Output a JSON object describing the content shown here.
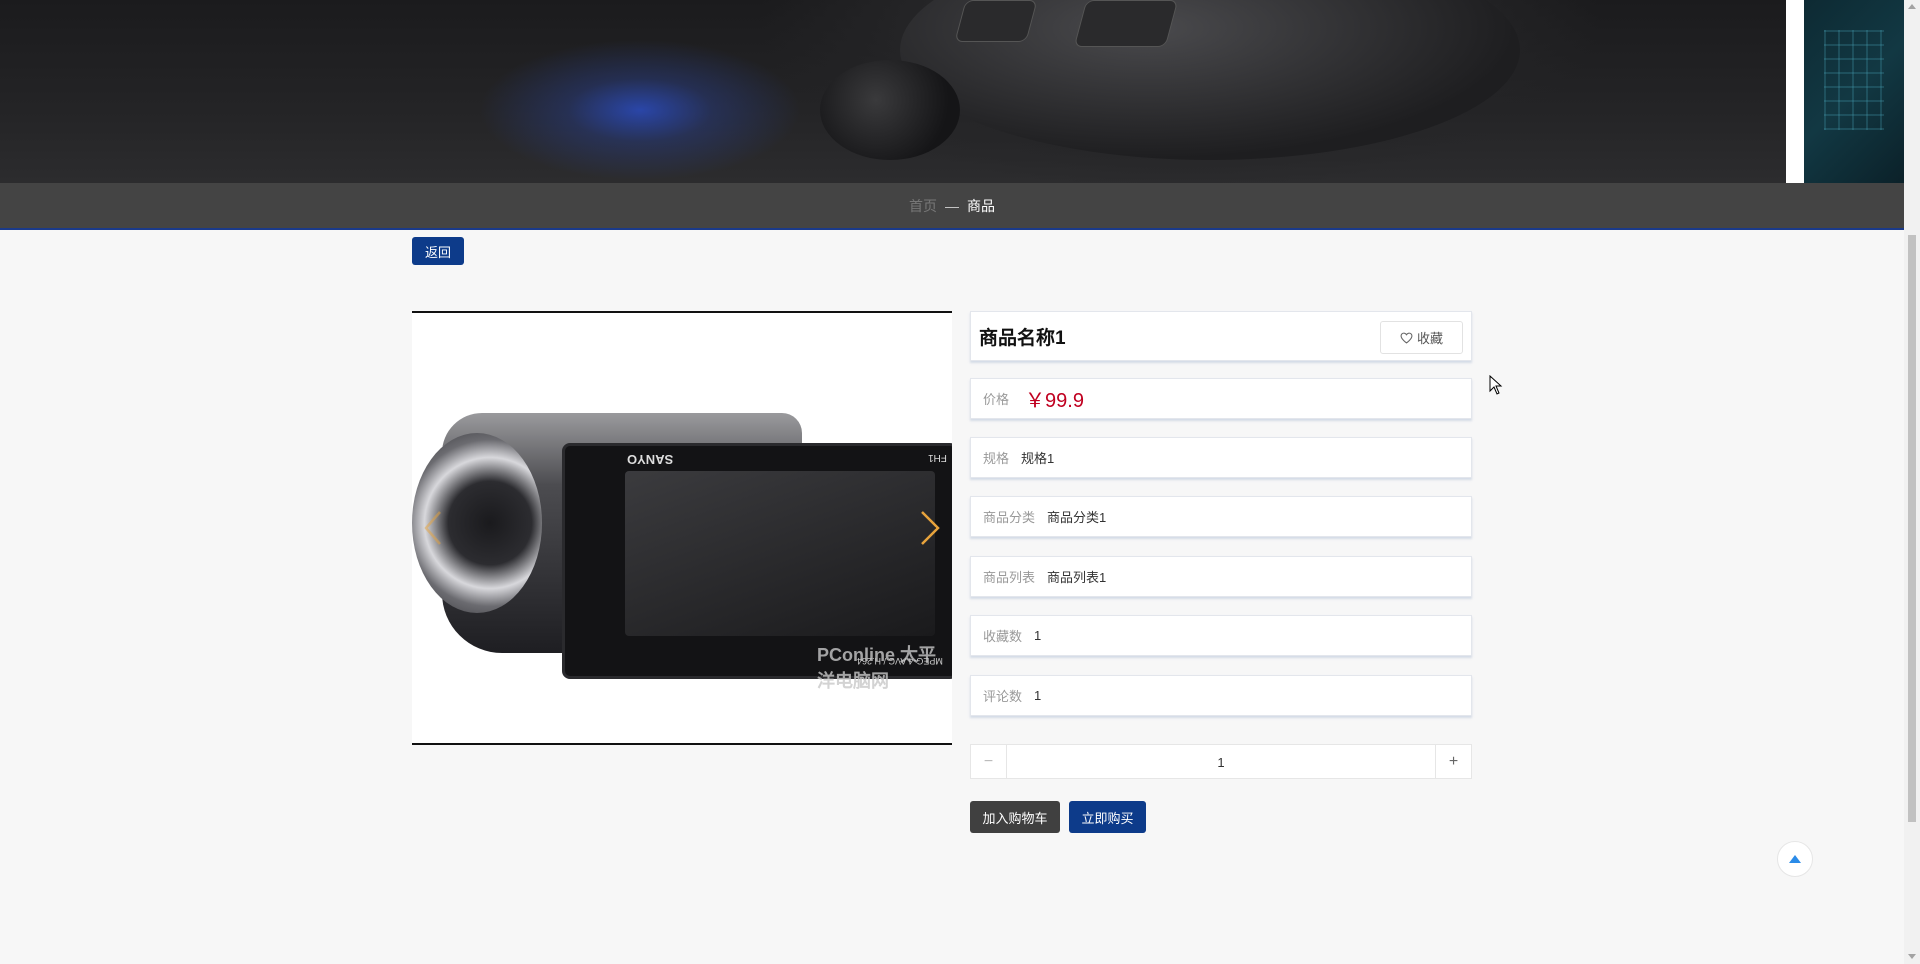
{
  "breadcrumb": {
    "home": "首页",
    "separator": "—",
    "current": "商品"
  },
  "back_label": "返回",
  "gallery": {
    "image_brand": "SANYO",
    "image_model": "FH1",
    "image_spec": "MPEG-4 AVC / H.264",
    "watermark": "PConline 太平洋电脑网",
    "prev_icon": "chevron-left-icon",
    "next_icon": "chevron-right-icon"
  },
  "product": {
    "name": "商品名称1",
    "favorite_label": "收藏",
    "favorite_icon": "heart-icon",
    "fields": [
      {
        "label": "价格",
        "value": "￥99.9"
      },
      {
        "label": "规格",
        "value": "规格1"
      },
      {
        "label": "商品分类",
        "value": "商品分类1"
      },
      {
        "label": "商品列表",
        "value": "商品列表1"
      },
      {
        "label": "收藏数",
        "value": "1"
      },
      {
        "label": "评论数",
        "value": "1"
      }
    ]
  },
  "quantity": {
    "minus": "−",
    "value": "1",
    "plus": "+"
  },
  "actions": {
    "add_to_cart": "加入购物车",
    "buy_now": "立即购买"
  },
  "colors": {
    "primary": "#0d3b8a",
    "dark_button": "#404040",
    "price": "#c00020",
    "breadcrumb_bg": "#444444",
    "arrow": "#e8a33c"
  }
}
